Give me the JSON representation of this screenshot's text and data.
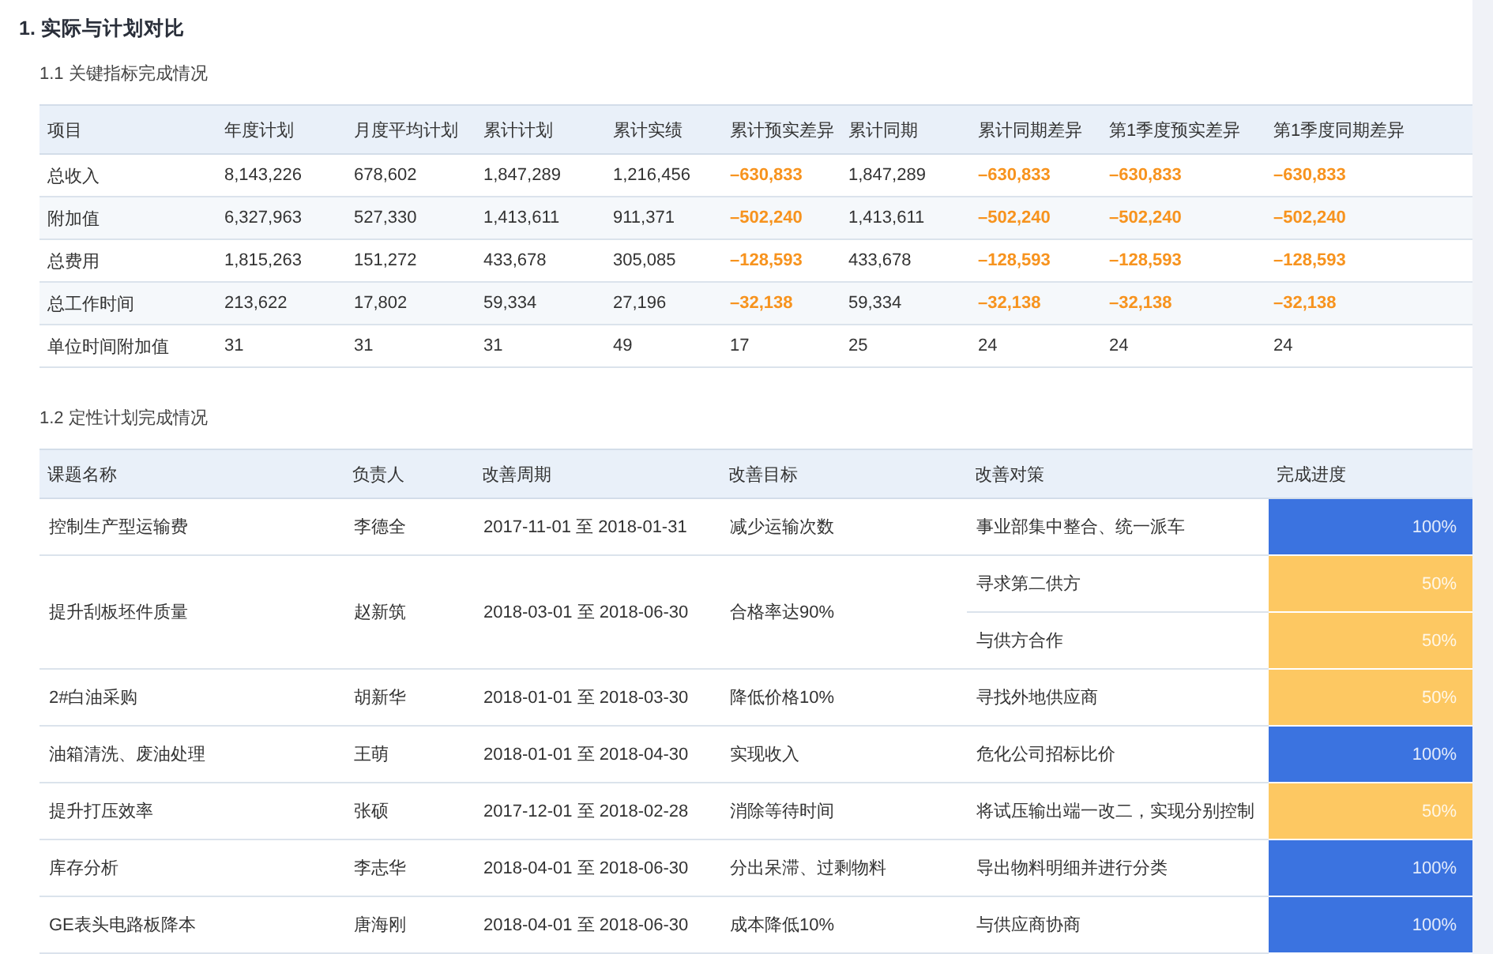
{
  "heading": "1. 实际与计划对比",
  "kpi_section": {
    "title": "1.1 关键指标完成情况",
    "columns": [
      "项目",
      "年度计划",
      "月度平均计划",
      "累计计划",
      "累计实绩",
      "累计预实差异",
      "累计同期",
      "累计同期差异",
      "第1季度预实差异",
      "第1季度同期差异"
    ],
    "rows": [
      [
        {
          "text": "总收入",
          "alert": false
        },
        {
          "text": "8,143,226",
          "alert": false
        },
        {
          "text": "678,602",
          "alert": false
        },
        {
          "text": "1,847,289",
          "alert": false
        },
        {
          "text": "1,216,456",
          "alert": false
        },
        {
          "text": "–630,833",
          "alert": true
        },
        {
          "text": "1,847,289",
          "alert": false
        },
        {
          "text": "–630,833",
          "alert": true
        },
        {
          "text": "–630,833",
          "alert": true
        },
        {
          "text": "–630,833",
          "alert": true
        }
      ],
      [
        {
          "text": "附加值",
          "alert": false
        },
        {
          "text": "6,327,963",
          "alert": false
        },
        {
          "text": "527,330",
          "alert": false
        },
        {
          "text": "1,413,611",
          "alert": false
        },
        {
          "text": "911,371",
          "alert": false
        },
        {
          "text": "–502,240",
          "alert": true
        },
        {
          "text": "1,413,611",
          "alert": false
        },
        {
          "text": "–502,240",
          "alert": true
        },
        {
          "text": "–502,240",
          "alert": true
        },
        {
          "text": "–502,240",
          "alert": true
        }
      ],
      [
        {
          "text": "总费用",
          "alert": false
        },
        {
          "text": "1,815,263",
          "alert": false
        },
        {
          "text": "151,272",
          "alert": false
        },
        {
          "text": "433,678",
          "alert": false
        },
        {
          "text": "305,085",
          "alert": false
        },
        {
          "text": "–128,593",
          "alert": true
        },
        {
          "text": "433,678",
          "alert": false
        },
        {
          "text": "–128,593",
          "alert": true
        },
        {
          "text": "–128,593",
          "alert": true
        },
        {
          "text": "–128,593",
          "alert": true
        }
      ],
      [
        {
          "text": "总工作时间",
          "alert": false
        },
        {
          "text": "213,622",
          "alert": false
        },
        {
          "text": "17,802",
          "alert": false
        },
        {
          "text": "59,334",
          "alert": false
        },
        {
          "text": "27,196",
          "alert": false
        },
        {
          "text": "–32,138",
          "alert": true
        },
        {
          "text": "59,334",
          "alert": false
        },
        {
          "text": "–32,138",
          "alert": true
        },
        {
          "text": "–32,138",
          "alert": true
        },
        {
          "text": "–32,138",
          "alert": true
        }
      ],
      [
        {
          "text": "单位时间附加值",
          "alert": false
        },
        {
          "text": "31",
          "alert": false
        },
        {
          "text": "31",
          "alert": false
        },
        {
          "text": "31",
          "alert": false
        },
        {
          "text": "49",
          "alert": false
        },
        {
          "text": "17",
          "alert": false
        },
        {
          "text": "25",
          "alert": false
        },
        {
          "text": "24",
          "alert": false
        },
        {
          "text": "24",
          "alert": false
        },
        {
          "text": "24",
          "alert": false
        }
      ]
    ]
  },
  "plan_section": {
    "title": "1.2 定性计划完成情况",
    "columns": [
      "课题名称",
      "负责人",
      "改善周期",
      "改善目标",
      "改善对策",
      "完成进度"
    ],
    "rows": [
      {
        "topic": "控制生产型运输费",
        "owner": "李德全",
        "period": "2017-11-01 至 2018-01-31",
        "goal": "减少运输次数",
        "measures": [
          {
            "text": "事业部集中整合、统一派车",
            "progress": "100%",
            "color": "#3b73e0"
          }
        ]
      },
      {
        "topic": "提升刮板坯件质量",
        "owner": "赵新筑",
        "period": "2018-03-01 至 2018-06-30",
        "goal": "合格率达90%",
        "measures": [
          {
            "text": "寻求第二供方",
            "progress": "50%",
            "color": "#fdc862"
          },
          {
            "text": "与供方合作",
            "progress": "50%",
            "color": "#fdc862"
          }
        ]
      },
      {
        "topic": "2#白油采购",
        "owner": "胡新华",
        "period": "2018-01-01 至 2018-03-30",
        "goal": "降低价格10%",
        "measures": [
          {
            "text": "寻找外地供应商",
            "progress": "50%",
            "color": "#fdc862"
          }
        ]
      },
      {
        "topic": "油箱清洗、废油处理",
        "owner": "王萌",
        "period": "2018-01-01 至 2018-04-30",
        "goal": "实现收入",
        "measures": [
          {
            "text": "危化公司招标比价",
            "progress": "100%",
            "color": "#3b73e0"
          }
        ]
      },
      {
        "topic": "提升打压效率",
        "owner": "张硕",
        "period": "2017-12-01 至 2018-02-28",
        "goal": "消除等待时间",
        "measures": [
          {
            "text": "将试压输出端一改二，实现分别控制",
            "progress": "50%",
            "color": "#fdc862"
          }
        ]
      },
      {
        "topic": "库存分析",
        "owner": "李志华",
        "period": "2018-04-01 至 2018-06-30",
        "goal": "分出呆滞、过剩物料",
        "measures": [
          {
            "text": "导出物料明细并进行分类",
            "progress": "100%",
            "color": "#3b73e0"
          }
        ]
      },
      {
        "topic": "GE表头电路板降本",
        "owner": "唐海刚",
        "period": "2018-04-01 至 2018-06-30",
        "goal": "成本降低10%",
        "measures": [
          {
            "text": "与供应商协商",
            "progress": "100%",
            "color": "#3b73e0"
          }
        ]
      }
    ]
  }
}
